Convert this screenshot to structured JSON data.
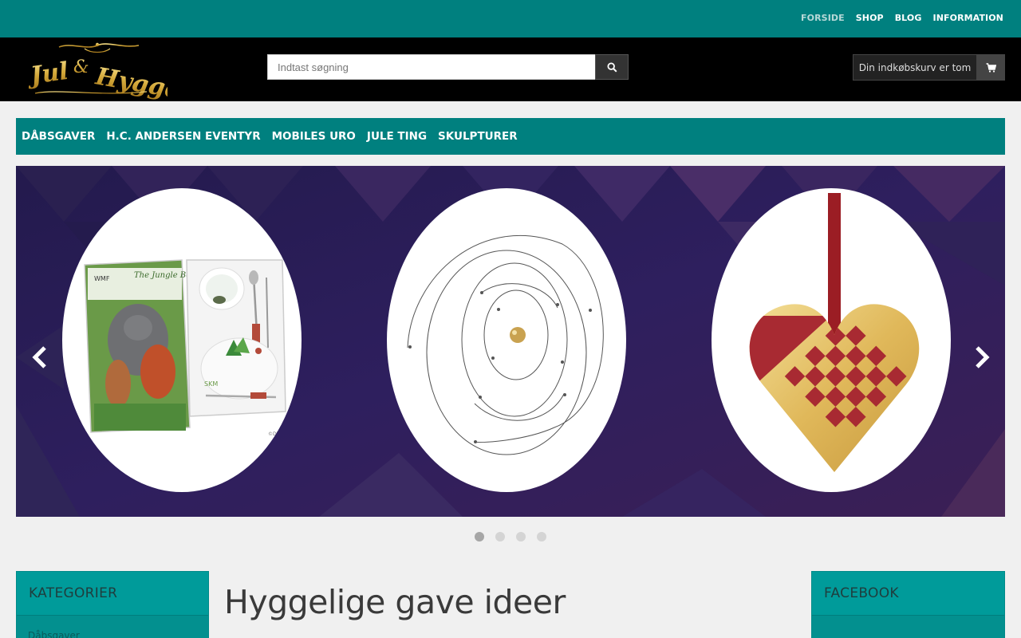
{
  "topnav": {
    "items": [
      {
        "label": "FORSIDE",
        "active": true
      },
      {
        "label": "SHOP",
        "active": false
      },
      {
        "label": "BLOG",
        "active": false
      },
      {
        "label": "INFORMATION",
        "active": false
      }
    ]
  },
  "header": {
    "logo_text": "Jul & Hygge",
    "search": {
      "placeholder": "Indtast søgning",
      "value": ""
    },
    "search_icon": "search-icon",
    "cart": {
      "label": "Din indkøbskurv er tom",
      "icon": "cart-icon"
    }
  },
  "categories": {
    "items": [
      "DÅBSGAVER",
      "H.C. ANDERSEN EVENTYR",
      "MOBILES URO",
      "JULE TING",
      "SKULPTURER"
    ]
  },
  "slider": {
    "prev_icon": "chevron-left-icon",
    "next_icon": "chevron-right-icon",
    "slides": [
      {
        "image": "jungle-book-cutlery-set",
        "box_text": "The Jungle Book",
        "brand": "WMF"
      },
      {
        "image": "mobile-orbit-uro"
      },
      {
        "image": "woven-heart-ornament"
      }
    ],
    "dots": 4,
    "active_dot": 0
  },
  "sidebar_left": {
    "title": "KATEGORIER",
    "first_item": "Dåbsgaver"
  },
  "main": {
    "title": "Hyggelige gave ideer"
  },
  "sidebar_right": {
    "title": "FACEBOOK"
  },
  "colors": {
    "teal": "#00807f",
    "header_bg": "#000000",
    "panel_teal": "#009b9a"
  }
}
